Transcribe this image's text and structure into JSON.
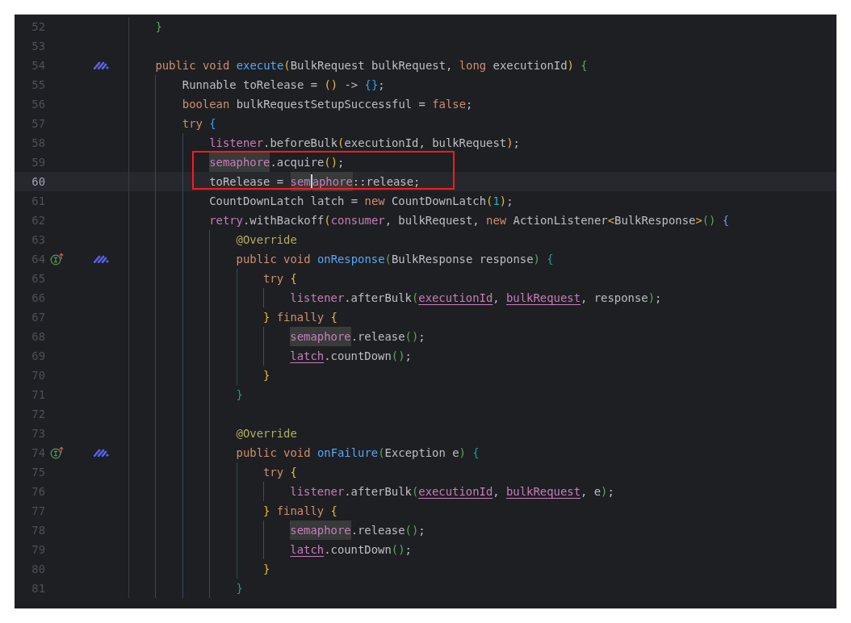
{
  "editor": {
    "lines": [
      {
        "number": "52",
        "current": false,
        "boxed": false,
        "implements": false,
        "marker": false,
        "tokens": [
          {
            "kind": "bracket2",
            "text": "}"
          }
        ]
      },
      {
        "number": "53",
        "current": false,
        "boxed": false,
        "implements": false,
        "marker": false
      },
      {
        "number": "54",
        "current": false,
        "boxed": false,
        "implements": false,
        "marker": true,
        "tokens": [
          {
            "kind": "keyword",
            "text": "public void "
          },
          {
            "kind": "method",
            "text": "execute"
          },
          {
            "kind": "bracket1",
            "text": "("
          },
          {
            "kind": "plain",
            "text": "BulkRequest bulkRequest, "
          },
          {
            "kind": "keyword",
            "text": "long "
          },
          {
            "kind": "plain",
            "text": "executionId"
          },
          {
            "kind": "bracket1",
            "text": ")"
          },
          {
            "kind": "bracket2",
            "text": " {"
          }
        ],
        "children": [
          {
            "number": "55",
            "current": false,
            "boxed": false,
            "implements": false,
            "marker": false,
            "tokens": [
              {
                "kind": "plain",
                "text": "Runnable toRelease = "
              },
              {
                "kind": "bracket1",
                "text": "()"
              },
              {
                "kind": "plain",
                "text": " -> "
              },
              {
                "kind": "bracket3",
                "text": "{}"
              },
              {
                "kind": "plain",
                "text": ";"
              }
            ]
          },
          {
            "number": "56",
            "current": false,
            "boxed": false,
            "implements": false,
            "marker": false,
            "tokens": [
              {
                "kind": "keyword",
                "text": "boolean "
              },
              {
                "kind": "plain",
                "text": "bulkRequestSetupSuccessful = "
              },
              {
                "kind": "keyword",
                "text": "false"
              },
              {
                "kind": "plain",
                "text": ";"
              }
            ]
          },
          {
            "number": "57",
            "current": false,
            "boxed": false,
            "implements": false,
            "marker": false,
            "tokens": [
              {
                "kind": "keyword",
                "text": "try "
              },
              {
                "kind": "bracket3",
                "text": "{"
              }
            ],
            "children": [
              {
                "number": "58",
                "current": false,
                "boxed": false,
                "implements": false,
                "marker": false,
                "tokens": [
                  {
                    "kind": "field",
                    "text": "listener"
                  },
                  {
                    "kind": "plain",
                    "text": ".beforeBulk"
                  },
                  {
                    "kind": "bracket1",
                    "text": "("
                  },
                  {
                    "kind": "plain",
                    "text": "executionId, bulkRequest"
                  },
                  {
                    "kind": "bracket1",
                    "text": ")"
                  },
                  {
                    "kind": "plain",
                    "text": ";"
                  }
                ]
              },
              {
                "number": "59",
                "current": false,
                "boxed": true,
                "implements": false,
                "marker": false,
                "tokens": [
                  {
                    "kind": "field",
                    "text": "semaphore",
                    "highlighted": true
                  },
                  {
                    "kind": "plain",
                    "text": ".acquire"
                  },
                  {
                    "kind": "bracket1",
                    "text": "()"
                  },
                  {
                    "kind": "plain",
                    "text": ";"
                  }
                ]
              },
              {
                "number": "60",
                "current": true,
                "boxed": true,
                "implements": false,
                "marker": false,
                "tokens": [
                  {
                    "kind": "plain",
                    "text": "toRelease = "
                  },
                  {
                    "kind": "field",
                    "text": "sem",
                    "highlighted": true
                  },
                  {
                    "kind": "caret"
                  },
                  {
                    "kind": "field",
                    "text": "aphore",
                    "highlighted": true
                  },
                  {
                    "kind": "plain",
                    "text": "::release;"
                  }
                ]
              },
              {
                "number": "61",
                "current": false,
                "boxed": false,
                "implements": false,
                "marker": false,
                "tokens": [
                  {
                    "kind": "plain",
                    "text": "CountDownLatch latch = "
                  },
                  {
                    "kind": "keyword",
                    "text": "new "
                  },
                  {
                    "kind": "plain",
                    "text": "CountDownLatch"
                  },
                  {
                    "kind": "bracket1",
                    "text": "("
                  },
                  {
                    "kind": "number",
                    "text": "1"
                  },
                  {
                    "kind": "bracket1",
                    "text": ")"
                  },
                  {
                    "kind": "plain",
                    "text": ";"
                  }
                ]
              },
              {
                "number": "62",
                "current": false,
                "boxed": false,
                "implements": false,
                "marker": false,
                "tokens": [
                  {
                    "kind": "field",
                    "text": "retry"
                  },
                  {
                    "kind": "plain",
                    "text": ".withBackoff"
                  },
                  {
                    "kind": "bracket1",
                    "text": "("
                  },
                  {
                    "kind": "field",
                    "text": "consumer"
                  },
                  {
                    "kind": "plain",
                    "text": ", bulkRequest, "
                  },
                  {
                    "kind": "keyword",
                    "text": "new "
                  },
                  {
                    "kind": "plain",
                    "text": "ActionListener"
                  },
                  {
                    "kind": "bracket1",
                    "text": "<"
                  },
                  {
                    "kind": "plain",
                    "text": "BulkResponse"
                  },
                  {
                    "kind": "bracket1",
                    "text": ">"
                  },
                  {
                    "kind": "bracket2",
                    "text": "()"
                  },
                  {
                    "kind": "bracket5",
                    "text": " {"
                  }
                ],
                "children": [
                  {
                    "number": "63",
                    "current": false,
                    "boxed": false,
                    "implements": false,
                    "marker": false,
                    "tokens": [
                      {
                        "kind": "annotation",
                        "text": "@Override"
                      }
                    ]
                  },
                  {
                    "number": "64",
                    "current": false,
                    "boxed": false,
                    "implements": true,
                    "marker": true,
                    "tokens": [
                      {
                        "kind": "keyword",
                        "text": "public void "
                      },
                      {
                        "kind": "method",
                        "text": "onResponse"
                      },
                      {
                        "kind": "bracket2",
                        "text": "("
                      },
                      {
                        "kind": "plain",
                        "text": "BulkResponse response"
                      },
                      {
                        "kind": "bracket2",
                        "text": ")"
                      },
                      {
                        "kind": "bracket4",
                        "text": " {"
                      }
                    ],
                    "children": [
                      {
                        "number": "65",
                        "current": false,
                        "boxed": false,
                        "implements": false,
                        "marker": false,
                        "tokens": [
                          {
                            "kind": "keyword",
                            "text": "try "
                          },
                          {
                            "kind": "bracket1",
                            "text": "{"
                          }
                        ],
                        "children": [
                          {
                            "number": "66",
                            "current": false,
                            "boxed": false,
                            "implements": false,
                            "marker": false,
                            "tokens": [
                              {
                                "kind": "field",
                                "text": "listener"
                              },
                              {
                                "kind": "plain",
                                "text": ".afterBulk"
                              },
                              {
                                "kind": "bracket2",
                                "text": "("
                              },
                              {
                                "kind": "field",
                                "text": "executionId",
                                "underlined": true
                              },
                              {
                                "kind": "plain",
                                "text": ", "
                              },
                              {
                                "kind": "field",
                                "text": "bulkRequest",
                                "underlined": true
                              },
                              {
                                "kind": "plain",
                                "text": ", response"
                              },
                              {
                                "kind": "bracket2",
                                "text": ")"
                              },
                              {
                                "kind": "plain",
                                "text": ";"
                              }
                            ]
                          }
                        ]
                      },
                      {
                        "number": "67",
                        "current": false,
                        "boxed": false,
                        "implements": false,
                        "marker": false,
                        "tokens": [
                          {
                            "kind": "bracket1",
                            "text": "}"
                          },
                          {
                            "kind": "keyword",
                            "text": " finally "
                          },
                          {
                            "kind": "bracket1",
                            "text": "{"
                          }
                        ],
                        "children": [
                          {
                            "number": "68",
                            "current": false,
                            "boxed": false,
                            "implements": false,
                            "marker": false,
                            "tokens": [
                              {
                                "kind": "field",
                                "text": "semaphore",
                                "highlighted": true
                              },
                              {
                                "kind": "plain",
                                "text": ".release"
                              },
                              {
                                "kind": "bracket2",
                                "text": "()"
                              },
                              {
                                "kind": "plain",
                                "text": ";"
                              }
                            ]
                          },
                          {
                            "number": "69",
                            "current": false,
                            "boxed": false,
                            "implements": false,
                            "marker": false,
                            "tokens": [
                              {
                                "kind": "field",
                                "text": "latch",
                                "underlined": true
                              },
                              {
                                "kind": "plain",
                                "text": ".countDown"
                              },
                              {
                                "kind": "bracket2",
                                "text": "()"
                              },
                              {
                                "kind": "plain",
                                "text": ";"
                              }
                            ]
                          }
                        ]
                      },
                      {
                        "number": "70",
                        "current": false,
                        "boxed": false,
                        "implements": false,
                        "marker": false,
                        "tokens": [
                          {
                            "kind": "bracket1",
                            "text": "}"
                          }
                        ]
                      }
                    ]
                  },
                  {
                    "number": "71",
                    "current": false,
                    "boxed": false,
                    "implements": false,
                    "marker": false,
                    "tokens": [
                      {
                        "kind": "bracket4",
                        "text": "}"
                      }
                    ]
                  },
                  {
                    "number": "72",
                    "current": false,
                    "boxed": false,
                    "implements": false,
                    "marker": false
                  },
                  {
                    "number": "73",
                    "current": false,
                    "boxed": false,
                    "implements": false,
                    "marker": false,
                    "tokens": [
                      {
                        "kind": "annotation",
                        "text": "@Override"
                      }
                    ]
                  },
                  {
                    "number": "74",
                    "current": false,
                    "boxed": false,
                    "implements": true,
                    "marker": true,
                    "tokens": [
                      {
                        "kind": "keyword",
                        "text": "public void "
                      },
                      {
                        "kind": "method",
                        "text": "onFailure"
                      },
                      {
                        "kind": "bracket2",
                        "text": "("
                      },
                      {
                        "kind": "plain",
                        "text": "Exception e"
                      },
                      {
                        "kind": "bracket2",
                        "text": ")"
                      },
                      {
                        "kind": "bracket4",
                        "text": " {"
                      }
                    ],
                    "children": [
                      {
                        "number": "75",
                        "current": false,
                        "boxed": false,
                        "implements": false,
                        "marker": false,
                        "tokens": [
                          {
                            "kind": "keyword",
                            "text": "try "
                          },
                          {
                            "kind": "bracket1",
                            "text": "{"
                          }
                        ],
                        "children": [
                          {
                            "number": "76",
                            "current": false,
                            "boxed": false,
                            "implements": false,
                            "marker": false,
                            "tokens": [
                              {
                                "kind": "field",
                                "text": "listener"
                              },
                              {
                                "kind": "plain",
                                "text": ".afterBulk"
                              },
                              {
                                "kind": "bracket2",
                                "text": "("
                              },
                              {
                                "kind": "field",
                                "text": "executionId",
                                "underlined": true
                              },
                              {
                                "kind": "plain",
                                "text": ", "
                              },
                              {
                                "kind": "field",
                                "text": "bulkRequest",
                                "underlined": true
                              },
                              {
                                "kind": "plain",
                                "text": ", e"
                              },
                              {
                                "kind": "bracket2",
                                "text": ")"
                              },
                              {
                                "kind": "plain",
                                "text": ";"
                              }
                            ]
                          }
                        ]
                      },
                      {
                        "number": "77",
                        "current": false,
                        "boxed": false,
                        "implements": false,
                        "marker": false,
                        "tokens": [
                          {
                            "kind": "bracket1",
                            "text": "}"
                          },
                          {
                            "kind": "keyword",
                            "text": " finally "
                          },
                          {
                            "kind": "bracket1",
                            "text": "{"
                          }
                        ],
                        "children": [
                          {
                            "number": "78",
                            "current": false,
                            "boxed": false,
                            "implements": false,
                            "marker": false,
                            "tokens": [
                              {
                                "kind": "field",
                                "text": "semaphore",
                                "highlighted": true
                              },
                              {
                                "kind": "plain",
                                "text": ".release"
                              },
                              {
                                "kind": "bracket2",
                                "text": "()"
                              },
                              {
                                "kind": "plain",
                                "text": ";"
                              }
                            ]
                          },
                          {
                            "number": "79",
                            "current": false,
                            "boxed": false,
                            "implements": false,
                            "marker": false,
                            "tokens": [
                              {
                                "kind": "field",
                                "text": "latch",
                                "underlined": true
                              },
                              {
                                "kind": "plain",
                                "text": ".countDown"
                              },
                              {
                                "kind": "bracket2",
                                "text": "()"
                              },
                              {
                                "kind": "plain",
                                "text": ";"
                              }
                            ]
                          }
                        ]
                      },
                      {
                        "number": "80",
                        "current": false,
                        "boxed": false,
                        "implements": false,
                        "marker": false,
                        "tokens": [
                          {
                            "kind": "bracket1",
                            "text": "}"
                          }
                        ]
                      }
                    ]
                  },
                  {
                    "number": "81",
                    "current": false,
                    "boxed": false,
                    "implements": false,
                    "marker": false,
                    "tokens": [
                      {
                        "kind": "bracket4",
                        "text": "}"
                      }
                    ]
                  }
                ]
              }
            ]
          }
        ]
      }
    ]
  }
}
